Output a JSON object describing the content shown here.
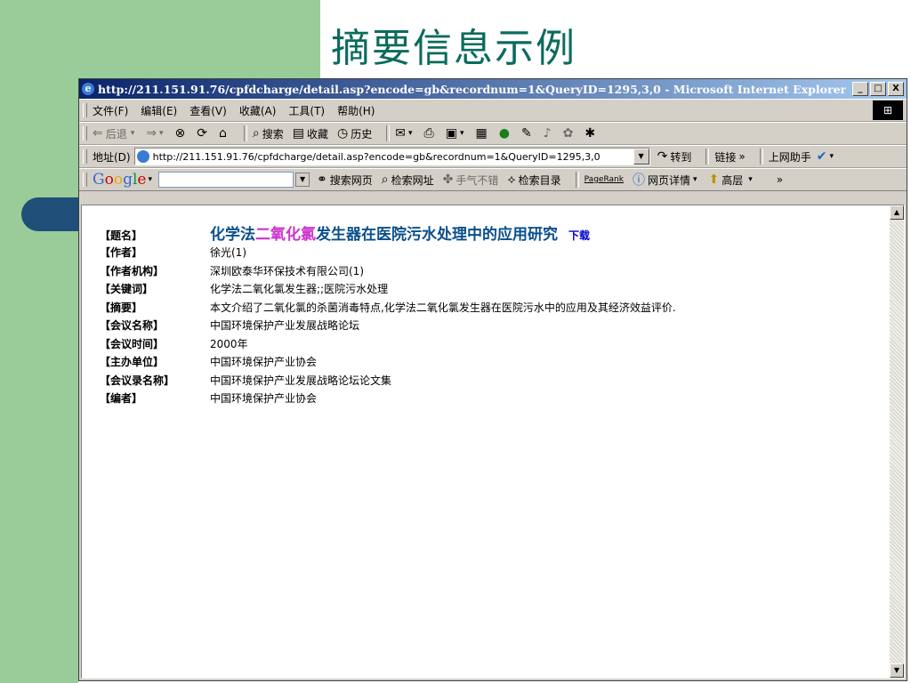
{
  "slide": {
    "title": "摘要信息示例"
  },
  "window": {
    "title": "http://211.151.91.76/cpfdcharge/detail.asp?encode=gb&recordnum=1&QueryID=1295,3,0 - Microsoft Internet Explorer",
    "controls": [
      "_",
      "□",
      "X"
    ]
  },
  "menu": {
    "items": [
      "文件(F)",
      "编辑(E)",
      "查看(V)",
      "收藏(A)",
      "工具(T)",
      "帮助(H)"
    ]
  },
  "toolbar": {
    "back": "后退",
    "search": "搜索",
    "favorites": "收藏",
    "history": "历史"
  },
  "address": {
    "label": "地址(D)",
    "url": "http://211.151.91.76/cpfdcharge/detail.asp?encode=gb&recordnum=1&QueryID=1295,3,0",
    "go": "转到",
    "links": "链接",
    "helper": "上网助手"
  },
  "google": {
    "logo": "Google",
    "search_web": "搜索网页",
    "search_site": "检索网址",
    "lucky": "手气不错",
    "directory": "检索目录",
    "pagerank": "PageRank",
    "page_info": "网页详情",
    "up": "高层"
  },
  "record": {
    "title_label": "【题名】",
    "title_part1": "化学法",
    "title_highlight": "二氧化氯",
    "title_part2": "发生器在医院污水处理中的应用研究",
    "download": "下载",
    "fields": [
      {
        "label": "【作者】",
        "value": "徐光(1)"
      },
      {
        "label": "【作者机构】",
        "value": "深圳欧泰华环保技术有限公司(1)"
      },
      {
        "label": "【关键词】",
        "value": "化学法二氧化氯发生器;;医院污水处理"
      },
      {
        "label": "【摘要】",
        "value": "本文介绍了二氧化氯的杀菌消毒特点,化学法二氧化氯发生器在医院污水中的应用及其经济效益评价."
      },
      {
        "label": "【会议名称】",
        "value": "中国环境保护产业发展战略论坛"
      },
      {
        "label": "【会议时间】",
        "value": "2000年"
      },
      {
        "label": "【主办单位】",
        "value": "中国环境保护产业协会"
      },
      {
        "label": "【会议录名称】",
        "value": "中国环境保护产业发展战略论坛论文集"
      },
      {
        "label": "【编者】",
        "value": "中国环境保护产业协会"
      }
    ]
  }
}
